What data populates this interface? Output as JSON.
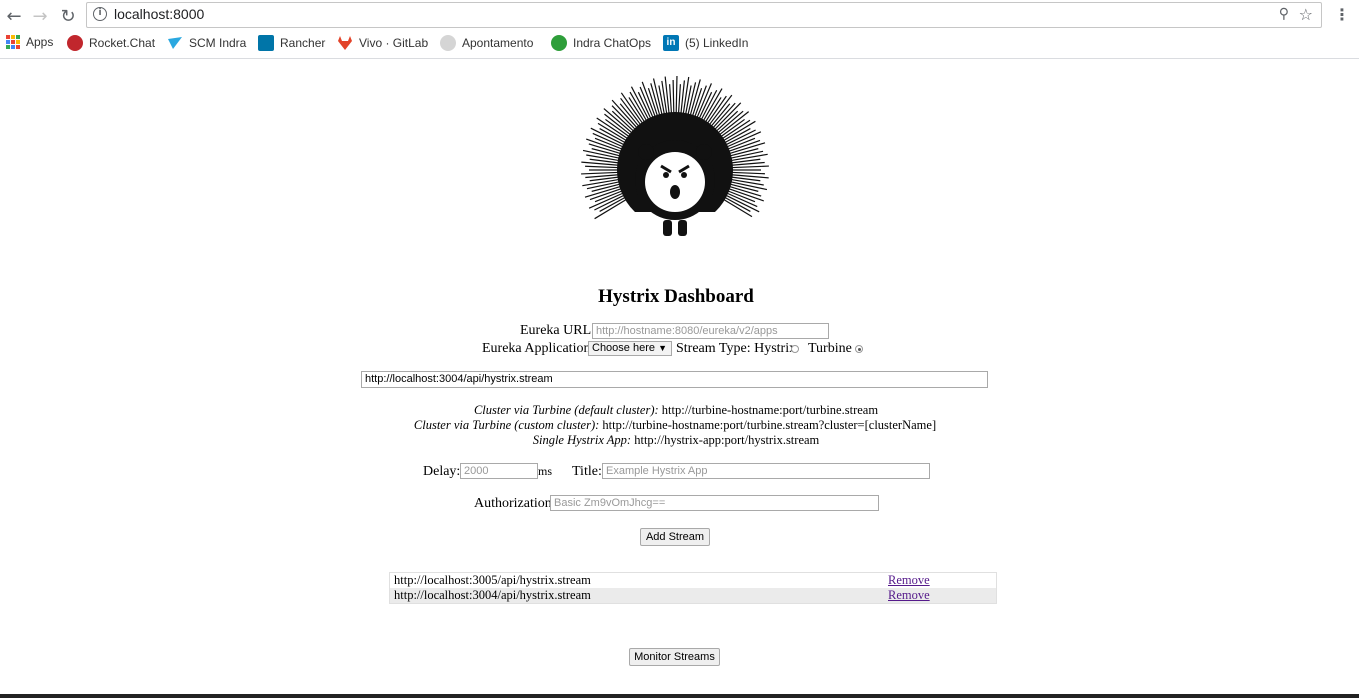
{
  "browser": {
    "url": "localhost:8000",
    "bookmarks": [
      {
        "label": "Apps",
        "icon": "apps-grid-icon"
      },
      {
        "label": "Rocket.Chat",
        "icon": "rocketchat-icon",
        "color": "#c1272d"
      },
      {
        "label": "SCM Indra",
        "icon": "scm-indra-icon",
        "color": "#2aa8e0"
      },
      {
        "label": "Rancher",
        "icon": "rancher-icon",
        "color": "#0075a8"
      },
      {
        "label": "Vivo · GitLab",
        "icon": "gitlab-icon",
        "color": "#e24329"
      },
      {
        "label": "Apontamento",
        "icon": "apontamento-icon",
        "color": "#bbbbbb"
      },
      {
        "label": "Indra ChatOps",
        "icon": "chatops-icon",
        "color": "#2e9e3a"
      },
      {
        "label": "(5) LinkedIn",
        "icon": "linkedin-icon",
        "color": "#0077b5"
      }
    ]
  },
  "page": {
    "title": "Hystrix Dashboard",
    "eureka_url_label": "Eureka URL:",
    "eureka_url_placeholder": "http://hostname:8080/eureka/v2/apps",
    "eureka_app_label": "Eureka Application:",
    "eureka_app_select": "Choose here",
    "stream_type_label": "Stream Type: Hystrix",
    "turbine_label": "Turbine",
    "stream_input_value": "http://localhost:3004/api/hystrix.stream",
    "hints": [
      {
        "label": "Cluster via Turbine (default cluster):",
        "value": "http://turbine-hostname:port/turbine.stream"
      },
      {
        "label": "Cluster via Turbine (custom cluster):",
        "value": "http://turbine-hostname:port/turbine.stream?cluster=[clusterName]"
      },
      {
        "label": "Single Hystrix App:",
        "value": "http://hystrix-app:port/hystrix.stream"
      }
    ],
    "delay_label": "Delay:",
    "delay_placeholder": "2000",
    "ms_label": "ms",
    "title_label": "Title:",
    "title_placeholder": "Example Hystrix App",
    "auth_label": "Authorization:",
    "auth_placeholder": "Basic Zm9vOmJhcg==",
    "add_stream_button": "Add Stream",
    "streams": [
      {
        "url": "http://localhost:3005/api/hystrix.stream",
        "action": "Remove"
      },
      {
        "url": "http://localhost:3004/api/hystrix.stream",
        "action": "Remove"
      }
    ],
    "monitor_button": "Monitor Streams"
  }
}
